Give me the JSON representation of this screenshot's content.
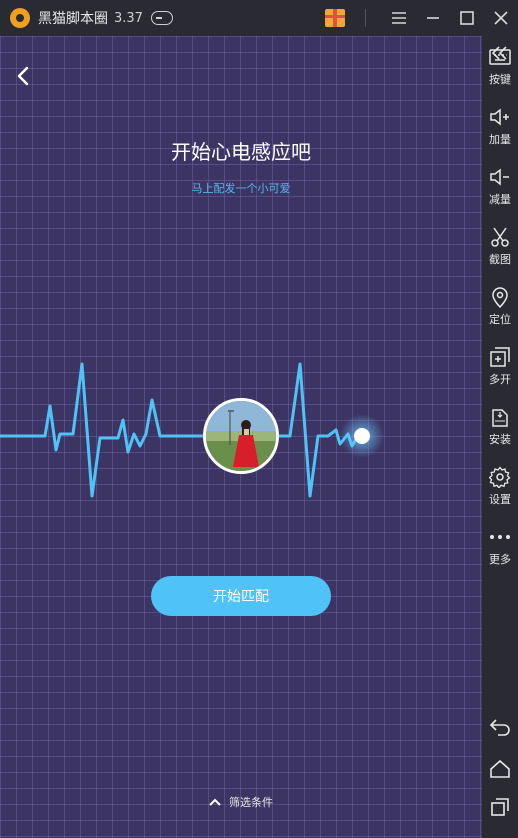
{
  "titlebar": {
    "app_title": "黑猫脚本圈",
    "version": "3.37",
    "icons": [
      "app-logo-icon",
      "gamepad-icon",
      "gift-icon",
      "menu-icon",
      "minimize-icon",
      "maximize-icon",
      "close-icon"
    ]
  },
  "sidebar": {
    "items": [
      {
        "label": "按键",
        "icon": "keyboard-icon"
      },
      {
        "label": "加量",
        "icon": "volume-up-icon"
      },
      {
        "label": "减量",
        "icon": "volume-down-icon"
      },
      {
        "label": "截图",
        "icon": "scissors-icon"
      },
      {
        "label": "定位",
        "icon": "location-pin-icon"
      },
      {
        "label": "多开",
        "icon": "multi-window-icon"
      },
      {
        "label": "安装",
        "icon": "apk-install-icon"
      },
      {
        "label": "设置",
        "icon": "gear-icon"
      },
      {
        "label": "更多",
        "icon": "more-dots-icon"
      }
    ],
    "nav": [
      "back-icon",
      "home-icon",
      "recent-apps-icon"
    ],
    "collapse": "double-chevron-left-icon"
  },
  "screen": {
    "title": "开始心电感应吧",
    "subtitle": "马上配发一个小可爱",
    "start_button": "开始匹配",
    "filter_label": "筛选条件"
  },
  "colors": {
    "background": "#3c3462",
    "accent": "#4fc3f7",
    "subtitle": "#55b8f0",
    "chrome": "#2a2a33"
  }
}
